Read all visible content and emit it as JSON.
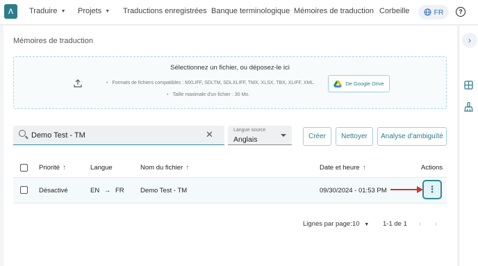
{
  "nav": {
    "logo_glyph": "ʌ",
    "items": [
      {
        "label": "Traduire",
        "has_dropdown": true
      },
      {
        "label": "Projets",
        "has_dropdown": true
      },
      {
        "label": "Traductions enregistrées"
      },
      {
        "label": "Banque terminologique"
      },
      {
        "label": "Mémoires de traduction"
      },
      {
        "label": "Corbeille"
      }
    ],
    "language": "FR",
    "help_glyph": "?"
  },
  "page": {
    "title": "Mémoires de traduction"
  },
  "dropzone": {
    "title": "Sélectionnez un fichier, ou déposez-le ici",
    "formats": "Formats de fichiers compatibles : MXLIFF, SDLTM, SDLXLIFF, TMX, XLSX, TBX, XLIFF, XML.",
    "max_size": "Taille maximale d'un fichier : 30 Mo.",
    "google_drive_label": "De Google Drive"
  },
  "toolbar": {
    "search_value": "Demo Test - TM",
    "source_lang_label": "Langue source",
    "source_lang_value": "Anglais",
    "create_label": "Créer",
    "clean_label": "Nettoyer",
    "ambiguity_label": "Analyse d'ambiguïté"
  },
  "table": {
    "headers": {
      "priority": "Priorité",
      "language": "Langue",
      "filename": "Nom du fichier",
      "datetime": "Date et heure",
      "actions": "Actions"
    },
    "rows": [
      {
        "priority": "Désactivé",
        "source_lang": "EN",
        "target_lang": "FR",
        "filename": "Demo Test - TM",
        "datetime": "09/30/2024 - 01:53 PM"
      }
    ]
  },
  "pagination": {
    "rows_per_page_label": "Lignes par page:",
    "rows_per_page_value": "10",
    "range": "1-1 de 1"
  },
  "colors": {
    "accent": "#2b7d8a",
    "annotation_arrow": "#d43030"
  }
}
